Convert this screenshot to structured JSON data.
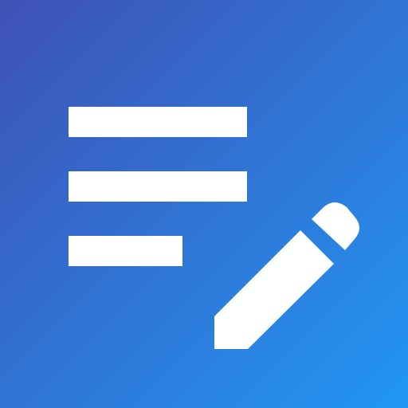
{
  "icon": {
    "name": "notes-edit-icon",
    "glyphs": [
      "text-lines-icon",
      "pencil-icon"
    ],
    "colors": {
      "gradient_start": "#3F51B5",
      "gradient_end": "#2196F3",
      "foreground": "#FFFFFF"
    }
  }
}
